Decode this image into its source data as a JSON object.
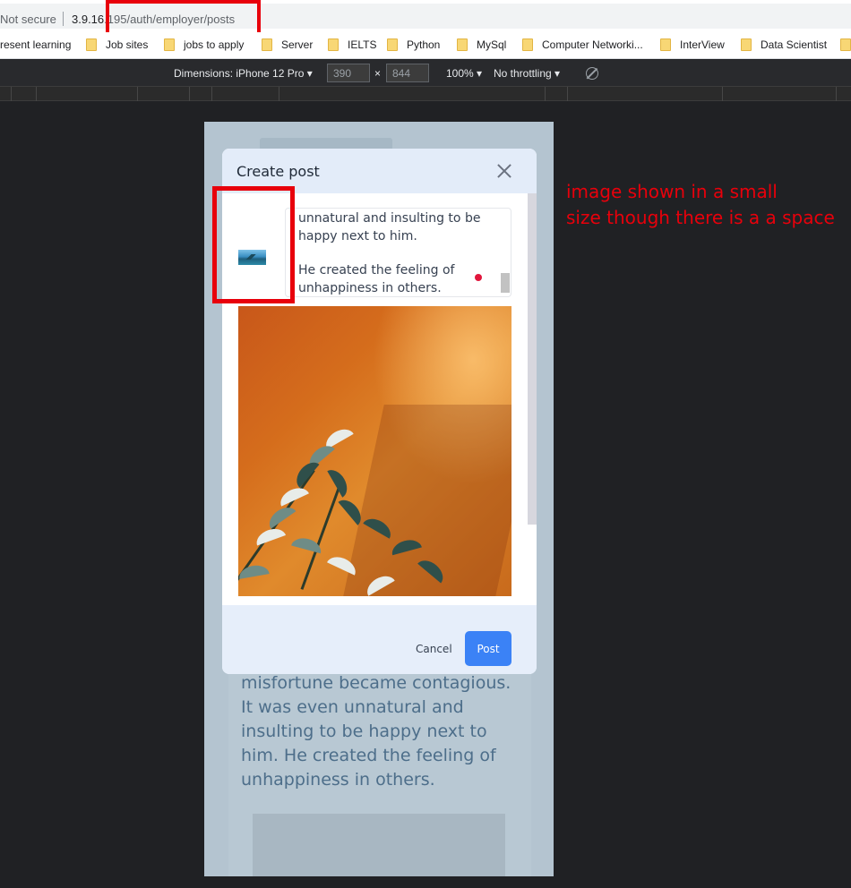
{
  "browser": {
    "security_label": "Not secure",
    "url_host": "3.9.16",
    "url_path": ".195/auth/employer/posts"
  },
  "bookmarks": [
    "resent learning",
    "Job sites",
    "jobs to apply",
    "Server",
    "IELTS",
    "Python",
    "MySql",
    "Computer Networki...",
    "InterView",
    "Data Scientist"
  ],
  "devtools": {
    "device_label": "Dimensions: iPhone 12 Pro ▾",
    "width": "390",
    "times": "×",
    "height": "844",
    "zoom": "100% ▾",
    "throttling": "No throttling ▾"
  },
  "background_post": {
    "text": "misfortune became contagious. It was even unnatural and insulting to be happy next to him. He created the feeling of unhappiness in others."
  },
  "modal": {
    "title": "Create post",
    "editor_paragraph_1": "unnatural and insulting to be happy next to him.",
    "editor_paragraph_2": "He created the feeling of unhappiness in others.",
    "cancel_label": "Cancel",
    "post_label": "Post"
  },
  "annotation": {
    "line1": "image shown in a small",
    "line2": "size though there is a a space"
  },
  "colors": {
    "highlight": "#e8000b",
    "primary_button": "#3b82f6"
  }
}
